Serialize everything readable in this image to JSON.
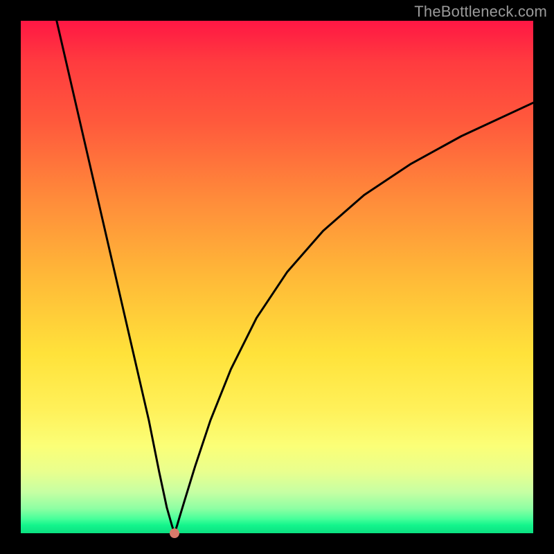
{
  "watermark": "TheBottleneck.com",
  "chart_data": {
    "type": "line",
    "title": "",
    "xlabel": "",
    "ylabel": "",
    "xlim": [
      0,
      100
    ],
    "ylim": [
      0,
      100
    ],
    "series": [
      {
        "name": "bottleneck-curve",
        "x": [
          7,
          10,
          13,
          16,
          19,
          22,
          25,
          27,
          28.5,
          29.5,
          30,
          30.5,
          31,
          32,
          34,
          37,
          41,
          46,
          52,
          59,
          67,
          76,
          86,
          100
        ],
        "values": [
          100,
          87,
          74,
          61,
          48,
          35,
          22,
          12,
          5,
          1.5,
          0,
          1.5,
          3.2,
          6.5,
          13,
          22,
          32,
          42,
          51,
          59,
          66,
          72,
          77.5,
          84
        ]
      }
    ],
    "marker": {
      "x": 30,
      "y": 0,
      "color": "#d77a6a",
      "radius_px": 7
    }
  },
  "colors": {
    "curve_stroke": "#000000",
    "marker_fill": "#d77a6a",
    "background_frame": "#000000"
  }
}
